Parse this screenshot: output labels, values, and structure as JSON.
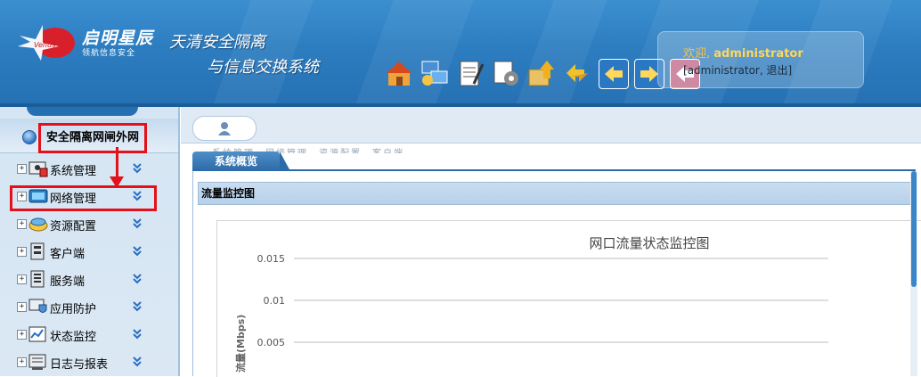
{
  "header": {
    "logo_text": "启明星辰",
    "logo_sub": "领航信息安全",
    "logo_badge": "Venus",
    "title_line1": "天清安全隔离",
    "title_line2": "与信息交换系统",
    "toolbar_icons": [
      "home-icon",
      "network-icon",
      "notes-icon",
      "settings-icon",
      "upload-icon",
      "sync-icon",
      "back-icon",
      "forward-icon",
      "exit-icon"
    ],
    "user": {
      "welcome_prefix": "欢迎,",
      "username": "administrator",
      "line2_open": "[",
      "line2_user": "administrator",
      "line2_sep": ",",
      "logout": "退出",
      "line2_close": "]"
    }
  },
  "sidebar": {
    "title": "安全隔离网闸外网",
    "items": [
      {
        "label": "系统管理",
        "expander": "+",
        "icon": "system-admin-icon"
      },
      {
        "label": "网络管理",
        "expander": "+",
        "icon": "network-icon"
      },
      {
        "label": "资源配置",
        "expander": "+",
        "icon": "resource-icon"
      },
      {
        "label": "客户端",
        "expander": "+",
        "icon": "client-icon"
      },
      {
        "label": "服务端",
        "expander": "+",
        "icon": "server-icon"
      },
      {
        "label": "应用防护",
        "expander": "+",
        "icon": "app-protect-icon"
      },
      {
        "label": "状态监控",
        "expander": "+",
        "icon": "status-monitor-icon"
      },
      {
        "label": "日志与报表",
        "expander": "+",
        "icon": "log-report-icon"
      }
    ]
  },
  "main": {
    "active_tab": "系统概览",
    "section_title": "流量监控图"
  },
  "colors": {
    "header_blue": "#2c7dc0",
    "highlight_red": "#e4101a",
    "tab_blue": "#2d6aa8",
    "welcome_gold": "#ffd75a"
  },
  "chart_data": {
    "type": "line",
    "title": "网口流量状态监控图",
    "ylabel": "流量(Mbps)",
    "xlabel": "",
    "yticks": [
      "0.015",
      "0.01",
      "0.005"
    ],
    "ytick_values": [
      0.015,
      0.01,
      0.005
    ],
    "series": [],
    "grid": true
  }
}
